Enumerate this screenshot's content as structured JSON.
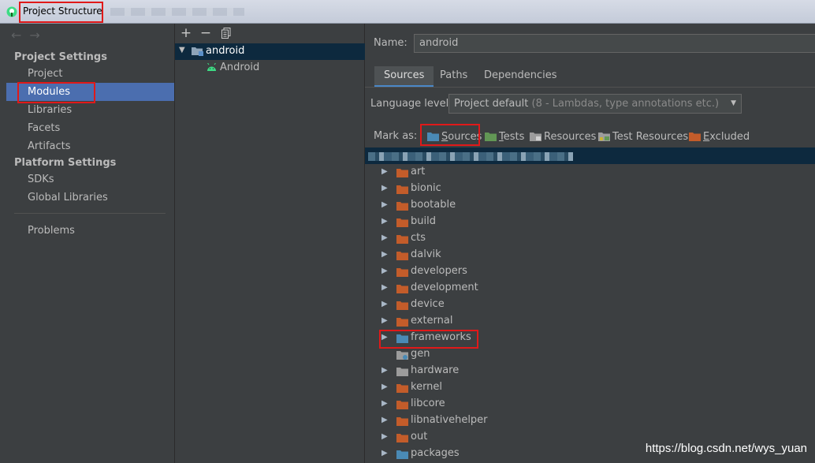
{
  "window": {
    "title": "Project Structure"
  },
  "sidebar": {
    "project_settings_heading": "Project Settings",
    "platform_settings_heading": "Platform Settings",
    "items": [
      {
        "label": "Project"
      },
      {
        "label": "Modules",
        "selected": true
      },
      {
        "label": "Libraries"
      },
      {
        "label": "Facets"
      },
      {
        "label": "Artifacts"
      },
      {
        "label": "SDKs"
      },
      {
        "label": "Global Libraries"
      },
      {
        "label": "Problems"
      }
    ]
  },
  "modules_panel": {
    "toolbar": {
      "add": "+",
      "remove": "−",
      "copy": "copy-icon"
    },
    "module": "android",
    "facet": "Android"
  },
  "module_editor": {
    "name_label": "Name:",
    "name_value": "android",
    "tabs": [
      {
        "label": "Sources",
        "active": true
      },
      {
        "label": "Paths"
      },
      {
        "label": "Dependencies"
      }
    ],
    "language_level_label": "Language level:",
    "language_level_value": "Project default",
    "language_level_hint": "(8 - Lambdas, type annotations etc.)",
    "mark_as_label": "Mark as:",
    "mark_as": {
      "sources": "ources",
      "sources_mnemonic": "S",
      "tests": "ests",
      "tests_mnemonic": "T",
      "resources": "Resources",
      "test_resources": "Test Resources",
      "excluded": "xcluded",
      "excluded_mnemonic": "E"
    },
    "mark_colors": {
      "sources": "#4a8ab5",
      "tests": "#629755",
      "resources": "#9c9c9c",
      "excluded": "#c35c2a"
    },
    "tree": [
      {
        "label": "art",
        "type": "excluded"
      },
      {
        "label": "bionic",
        "type": "excluded"
      },
      {
        "label": "bootable",
        "type": "excluded"
      },
      {
        "label": "build",
        "type": "excluded"
      },
      {
        "label": "cts",
        "type": "excluded"
      },
      {
        "label": "dalvik",
        "type": "excluded"
      },
      {
        "label": "developers",
        "type": "excluded"
      },
      {
        "label": "development",
        "type": "excluded"
      },
      {
        "label": "device",
        "type": "excluded"
      },
      {
        "label": "external",
        "type": "excluded"
      },
      {
        "label": "frameworks",
        "type": "source"
      },
      {
        "label": "gen",
        "type": "generated"
      },
      {
        "label": "hardware",
        "type": "plain"
      },
      {
        "label": "kernel",
        "type": "excluded"
      },
      {
        "label": "libcore",
        "type": "excluded"
      },
      {
        "label": "libnativehelper",
        "type": "excluded"
      },
      {
        "label": "out",
        "type": "excluded"
      },
      {
        "label": "packages",
        "type": "source"
      }
    ]
  },
  "watermark": "https://blog.csdn.net/wys_yuan"
}
